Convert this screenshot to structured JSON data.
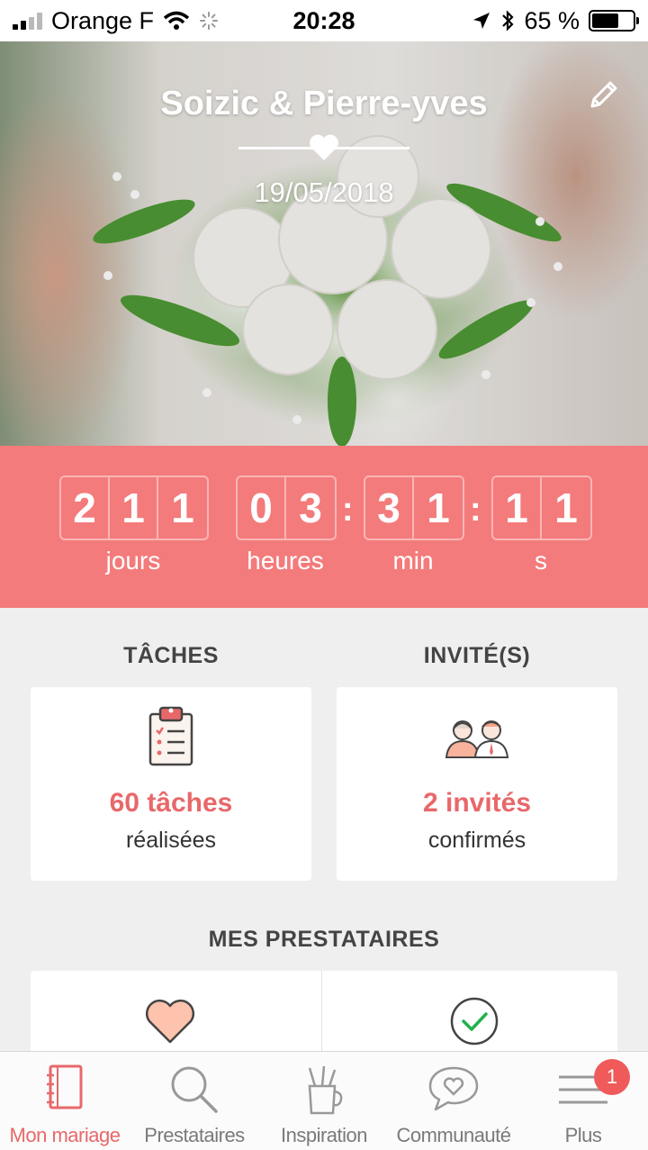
{
  "status_bar": {
    "carrier": "Orange F",
    "time": "20:28",
    "battery_percent": "65 %",
    "battery_level": 0.65
  },
  "hero": {
    "couple": "Soizic & Pierre-yves",
    "date": "19/05/2018"
  },
  "countdown": {
    "days": [
      "2",
      "1",
      "1"
    ],
    "hours": [
      "0",
      "3"
    ],
    "minutes": [
      "3",
      "1"
    ],
    "seconds": [
      "1",
      "1"
    ],
    "labels": {
      "days": "jours",
      "hours": "heures",
      "minutes": "min",
      "seconds": "s"
    },
    "separator": ":",
    "color": "#f47b7b"
  },
  "tasks": {
    "title": "TÂCHES",
    "count": "60 tâches",
    "sub": "réalisées"
  },
  "guests": {
    "title": "INVITÉ(S)",
    "count": "2 invités",
    "sub": "confirmés"
  },
  "vendors": {
    "title": "MES PRESTATAIRES"
  },
  "tab_bar": {
    "items": [
      {
        "label": "Mon mariage",
        "icon": "notebook-icon",
        "active": true
      },
      {
        "label": "Prestataires",
        "icon": "search-icon",
        "active": false
      },
      {
        "label": "Inspiration",
        "icon": "pencil-cup-icon",
        "active": false
      },
      {
        "label": "Communauté",
        "icon": "chat-heart-icon",
        "active": false
      },
      {
        "label": "Plus",
        "icon": "menu-icon",
        "active": false,
        "badge": "1"
      }
    ]
  },
  "accent_color": "#e8686a"
}
